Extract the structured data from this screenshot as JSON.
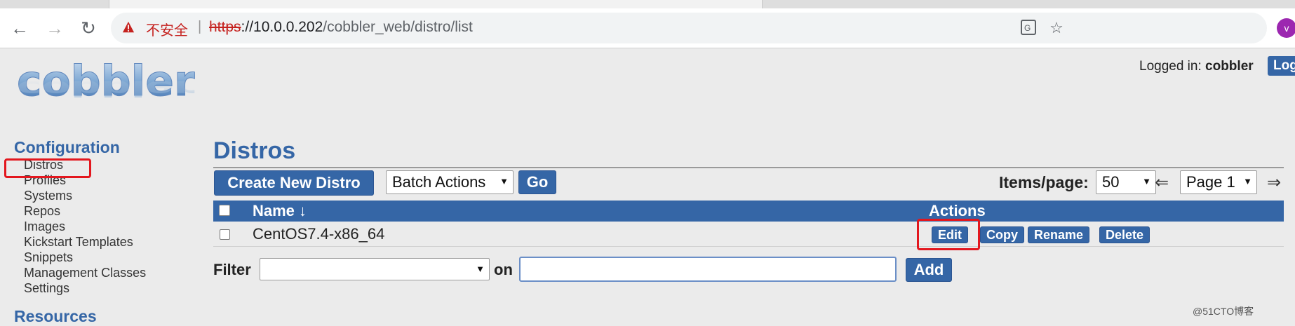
{
  "browser": {
    "security_label": "不安全",
    "separator": "|",
    "url_scheme": "https",
    "url_rest": "://10.0.0.202",
    "url_path": "/cobbler_web/distro/list",
    "avatar_initial": "v"
  },
  "header": {
    "logo_text": "cobbler",
    "login_prefix": "Logged in:",
    "login_user": "cobbler",
    "logout_label": "Log"
  },
  "sidebar": {
    "heading": "Configuration",
    "items": [
      "Distros",
      "Profiles",
      "Systems",
      "Repos",
      "Images",
      "Kickstart Templates",
      "Snippets",
      "Management Classes",
      "Settings"
    ],
    "heading2": "Resources"
  },
  "main": {
    "title": "Distros",
    "create_label": "Create New Distro",
    "batch_actions": "Batch Actions",
    "go_label": "Go",
    "items_per_page_label": "Items/page:",
    "items_per_page": "50",
    "page_label": "Page 1",
    "prev_arrow": "⇐",
    "next_arrow": "⇒",
    "table": {
      "col_name": "Name ↓",
      "col_actions": "Actions",
      "rows": [
        {
          "name": "CentOS7.4-x86_64",
          "actions": [
            "Edit",
            "Copy",
            "Rename",
            "Delete"
          ]
        }
      ]
    },
    "filter_label": "Filter",
    "filter_on": "on",
    "add_label": "Add"
  },
  "watermark": "@51CTO博客",
  "colors": {
    "accent": "#3566a6",
    "highlight": "#e3171e",
    "page_bg": "#ebebeb"
  }
}
